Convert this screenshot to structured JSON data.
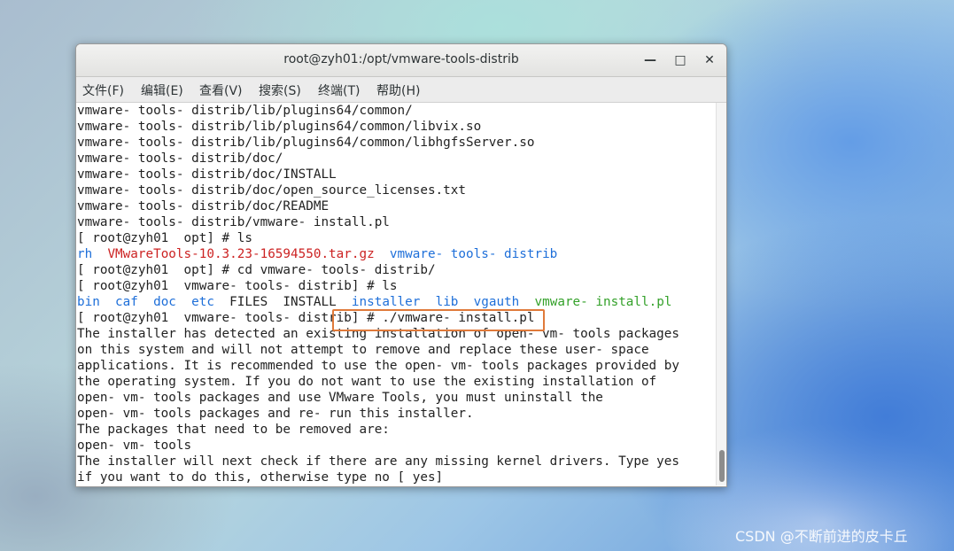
{
  "window": {
    "title": "root@zyh01:/opt/vmware-tools-distrib",
    "minimize_icon": "minimize-icon",
    "maximize_icon": "maximize-icon",
    "close_icon": "close-icon"
  },
  "menubar": {
    "items": [
      "文件(F)",
      "编辑(E)",
      "查看(V)",
      "搜索(S)",
      "终端(T)",
      "帮助(H)"
    ]
  },
  "terminal": {
    "lines": [
      {
        "text": "vmware- tools- distrib/lib/plugins64/common/"
      },
      {
        "text": "vmware- tools- distrib/lib/plugins64/common/libvix.so"
      },
      {
        "text": "vmware- tools- distrib/lib/plugins64/common/libhgfsServer.so"
      },
      {
        "text": "vmware- tools- distrib/doc/"
      },
      {
        "text": "vmware- tools- distrib/doc/INSTALL"
      },
      {
        "text": "vmware- tools- distrib/doc/open_source_licenses.txt"
      },
      {
        "text": "vmware- tools- distrib/doc/README"
      },
      {
        "text": "vmware- tools- distrib/vmware- install.pl"
      },
      {
        "text": "[ root@zyh01  opt] # ls"
      },
      {
        "segments": [
          {
            "text": "rh",
            "color": "blue"
          },
          {
            "text": "  ",
            "color": "default"
          },
          {
            "text": "VMwareTools-10.3.23-16594550.tar.gz",
            "color": "red"
          },
          {
            "text": "  ",
            "color": "default"
          },
          {
            "text": "vmware- tools- distrib",
            "color": "blue"
          }
        ]
      },
      {
        "text": "[ root@zyh01  opt] # cd vmware- tools- distrib/"
      },
      {
        "text": "[ root@zyh01  vmware- tools- distrib] # ls"
      },
      {
        "segments": [
          {
            "text": "bin",
            "color": "blue"
          },
          {
            "text": "  ",
            "color": "default"
          },
          {
            "text": "caf",
            "color": "blue"
          },
          {
            "text": "  ",
            "color": "default"
          },
          {
            "text": "doc",
            "color": "blue"
          },
          {
            "text": "  ",
            "color": "default"
          },
          {
            "text": "etc",
            "color": "blue"
          },
          {
            "text": "  FILES  INSTALL  ",
            "color": "default"
          },
          {
            "text": "installer",
            "color": "blue"
          },
          {
            "text": "  ",
            "color": "default"
          },
          {
            "text": "lib",
            "color": "blue"
          },
          {
            "text": "  ",
            "color": "default"
          },
          {
            "text": "vgauth",
            "color": "blue"
          },
          {
            "text": "  ",
            "color": "default"
          },
          {
            "text": "vmware- install.pl",
            "color": "green"
          }
        ]
      },
      {
        "text": "[ root@zyh01  vmware- tools- distrib] # ./vmware- install.pl"
      },
      {
        "text": "The installer has detected an existing installation of open- vm- tools packages"
      },
      {
        "text": "on this system and will not attempt to remove and replace these user- space"
      },
      {
        "text": "applications. It is recommended to use the open- vm- tools packages provided by"
      },
      {
        "text": "the operating system. If you do not want to use the existing installation of"
      },
      {
        "text": "open- vm- tools packages and use VMware Tools, you must uninstall the"
      },
      {
        "text": "open- vm- tools packages and re- run this installer."
      },
      {
        "text": "The packages that need to be removed are:"
      },
      {
        "text": "open- vm- tools"
      },
      {
        "text": "The installer will next check if there are any missing kernel drivers. Type yes"
      },
      {
        "text": "if you want to do this, otherwise type no [ yes]"
      }
    ]
  },
  "watermark": "CSDN @不断前进的皮卡丘",
  "colors": {
    "default": "#222222",
    "red": "#cc2222",
    "blue": "#1e6fd9",
    "green": "#34a12a",
    "highlight": "#e07a3a"
  }
}
